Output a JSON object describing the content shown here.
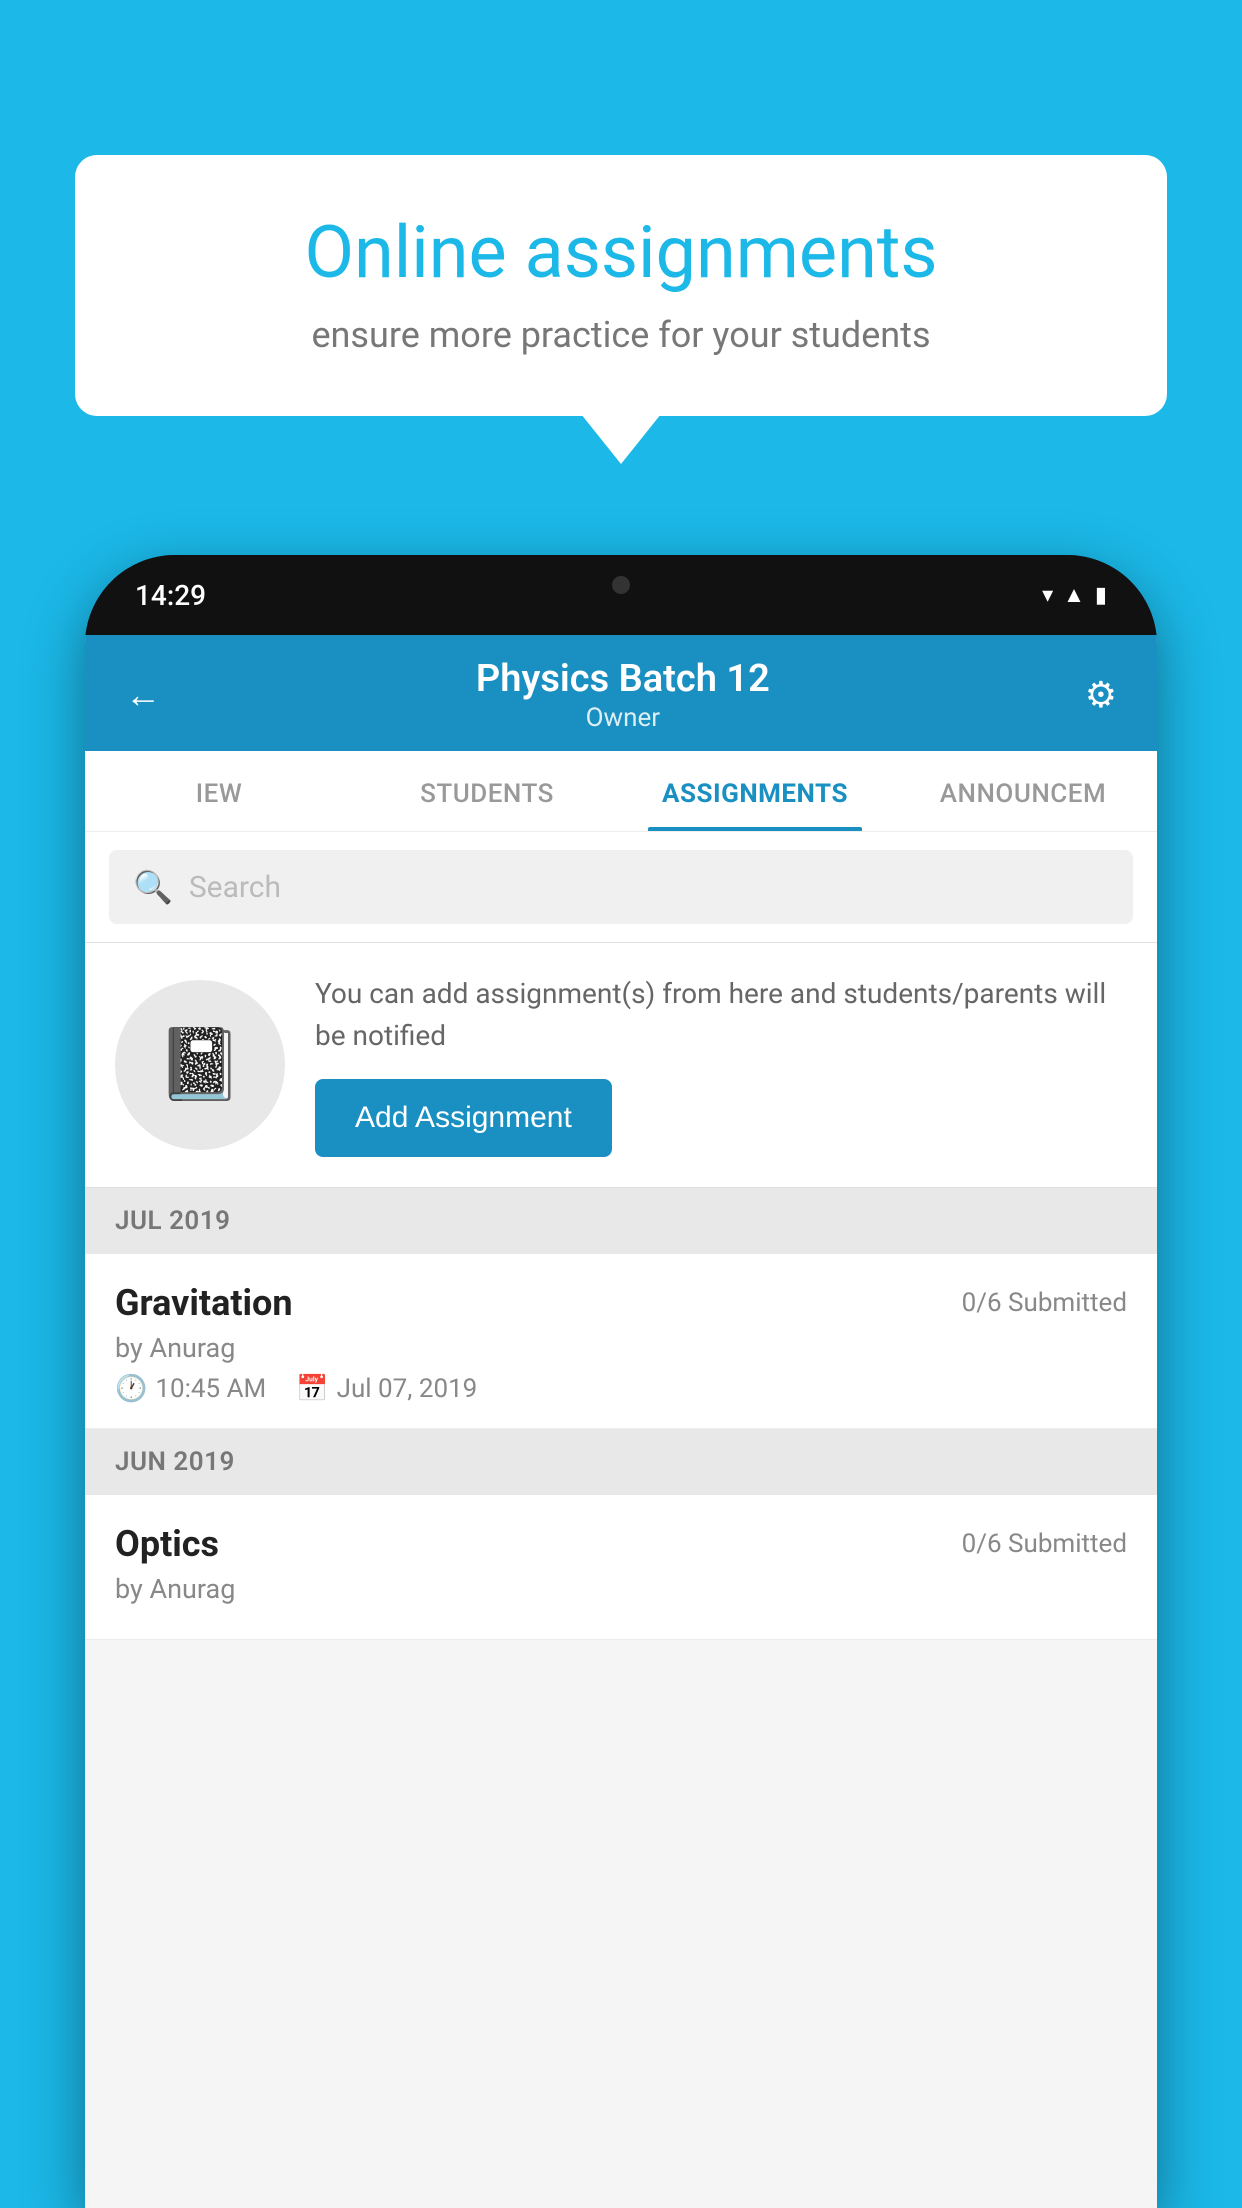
{
  "background": {
    "color": "#1bb8e8"
  },
  "speech_bubble": {
    "title": "Online assignments",
    "subtitle": "ensure more practice for your students"
  },
  "phone": {
    "time": "14:29",
    "header": {
      "title": "Physics Batch 12",
      "subtitle": "Owner",
      "back_label": "←",
      "gear_label": "⚙"
    },
    "tabs": [
      {
        "label": "IEW",
        "active": false
      },
      {
        "label": "STUDENTS",
        "active": false
      },
      {
        "label": "ASSIGNMENTS",
        "active": true
      },
      {
        "label": "ANNOUNCEM",
        "active": false
      }
    ],
    "search": {
      "placeholder": "Search"
    },
    "promo": {
      "description": "You can add assignment(s) from here and students/parents will be notified",
      "button_label": "Add Assignment"
    },
    "sections": [
      {
        "header": "JUL 2019",
        "assignments": [
          {
            "name": "Gravitation",
            "submitted": "0/6 Submitted",
            "by": "by Anurag",
            "time": "10:45 AM",
            "date": "Jul 07, 2019"
          }
        ]
      },
      {
        "header": "JUN 2019",
        "assignments": [
          {
            "name": "Optics",
            "submitted": "0/6 Submitted",
            "by": "by Anurag",
            "time": "",
            "date": ""
          }
        ]
      }
    ]
  }
}
